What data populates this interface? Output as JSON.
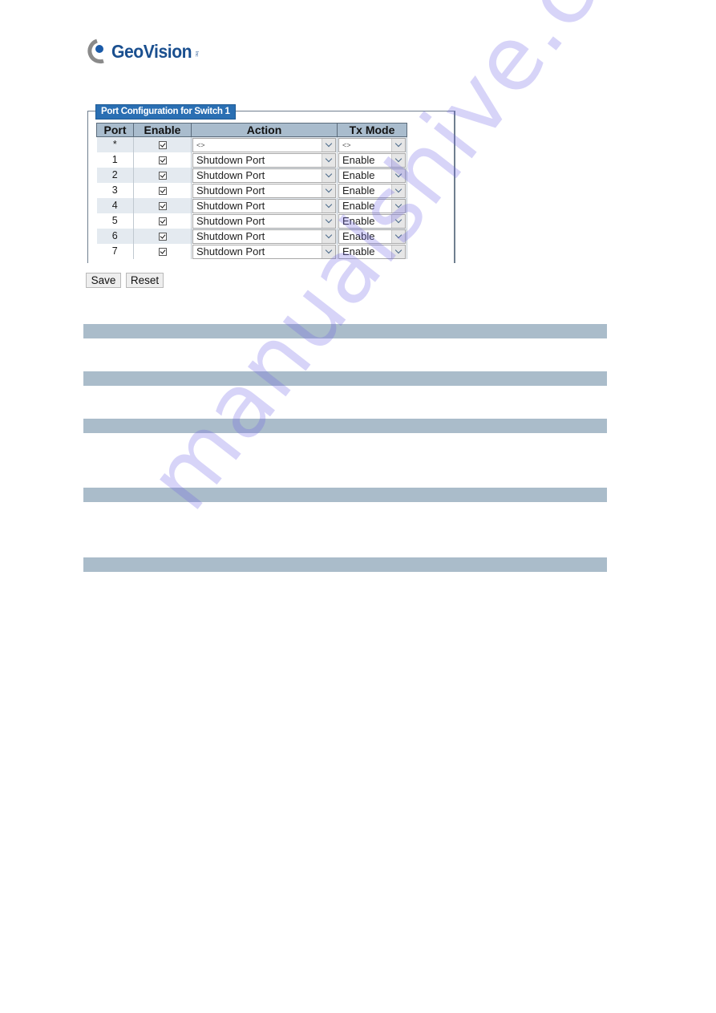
{
  "logo": {
    "brand": "GeoVision",
    "suffix": "Inc",
    "icon": "geovision-logo-icon"
  },
  "panel": {
    "legend": "Port Configuration for Switch 1",
    "columns": [
      "Port",
      "Enable",
      "Action",
      "Tx Mode"
    ],
    "rows": [
      {
        "port": "*",
        "enable": true,
        "action": "<>",
        "tx_mode": "<>"
      },
      {
        "port": "1",
        "enable": true,
        "action": "Shutdown Port",
        "tx_mode": "Enable"
      },
      {
        "port": "2",
        "enable": true,
        "action": "Shutdown Port",
        "tx_mode": "Enable"
      },
      {
        "port": "3",
        "enable": true,
        "action": "Shutdown Port",
        "tx_mode": "Enable"
      },
      {
        "port": "4",
        "enable": true,
        "action": "Shutdown Port",
        "tx_mode": "Enable"
      },
      {
        "port": "5",
        "enable": true,
        "action": "Shutdown Port",
        "tx_mode": "Enable"
      },
      {
        "port": "6",
        "enable": true,
        "action": "Shutdown Port",
        "tx_mode": "Enable"
      },
      {
        "port": "7",
        "enable": true,
        "action": "Shutdown Port",
        "tx_mode": "Enable"
      }
    ]
  },
  "buttons": {
    "save": "Save",
    "reset": "Reset"
  },
  "section_bars": 5,
  "watermark": "manualshive.com",
  "colors": {
    "legend_bg": "#2a6fb3",
    "header_bg": "#a9bccd",
    "bar": "#aabcca",
    "brand": "#1a4f8f"
  }
}
